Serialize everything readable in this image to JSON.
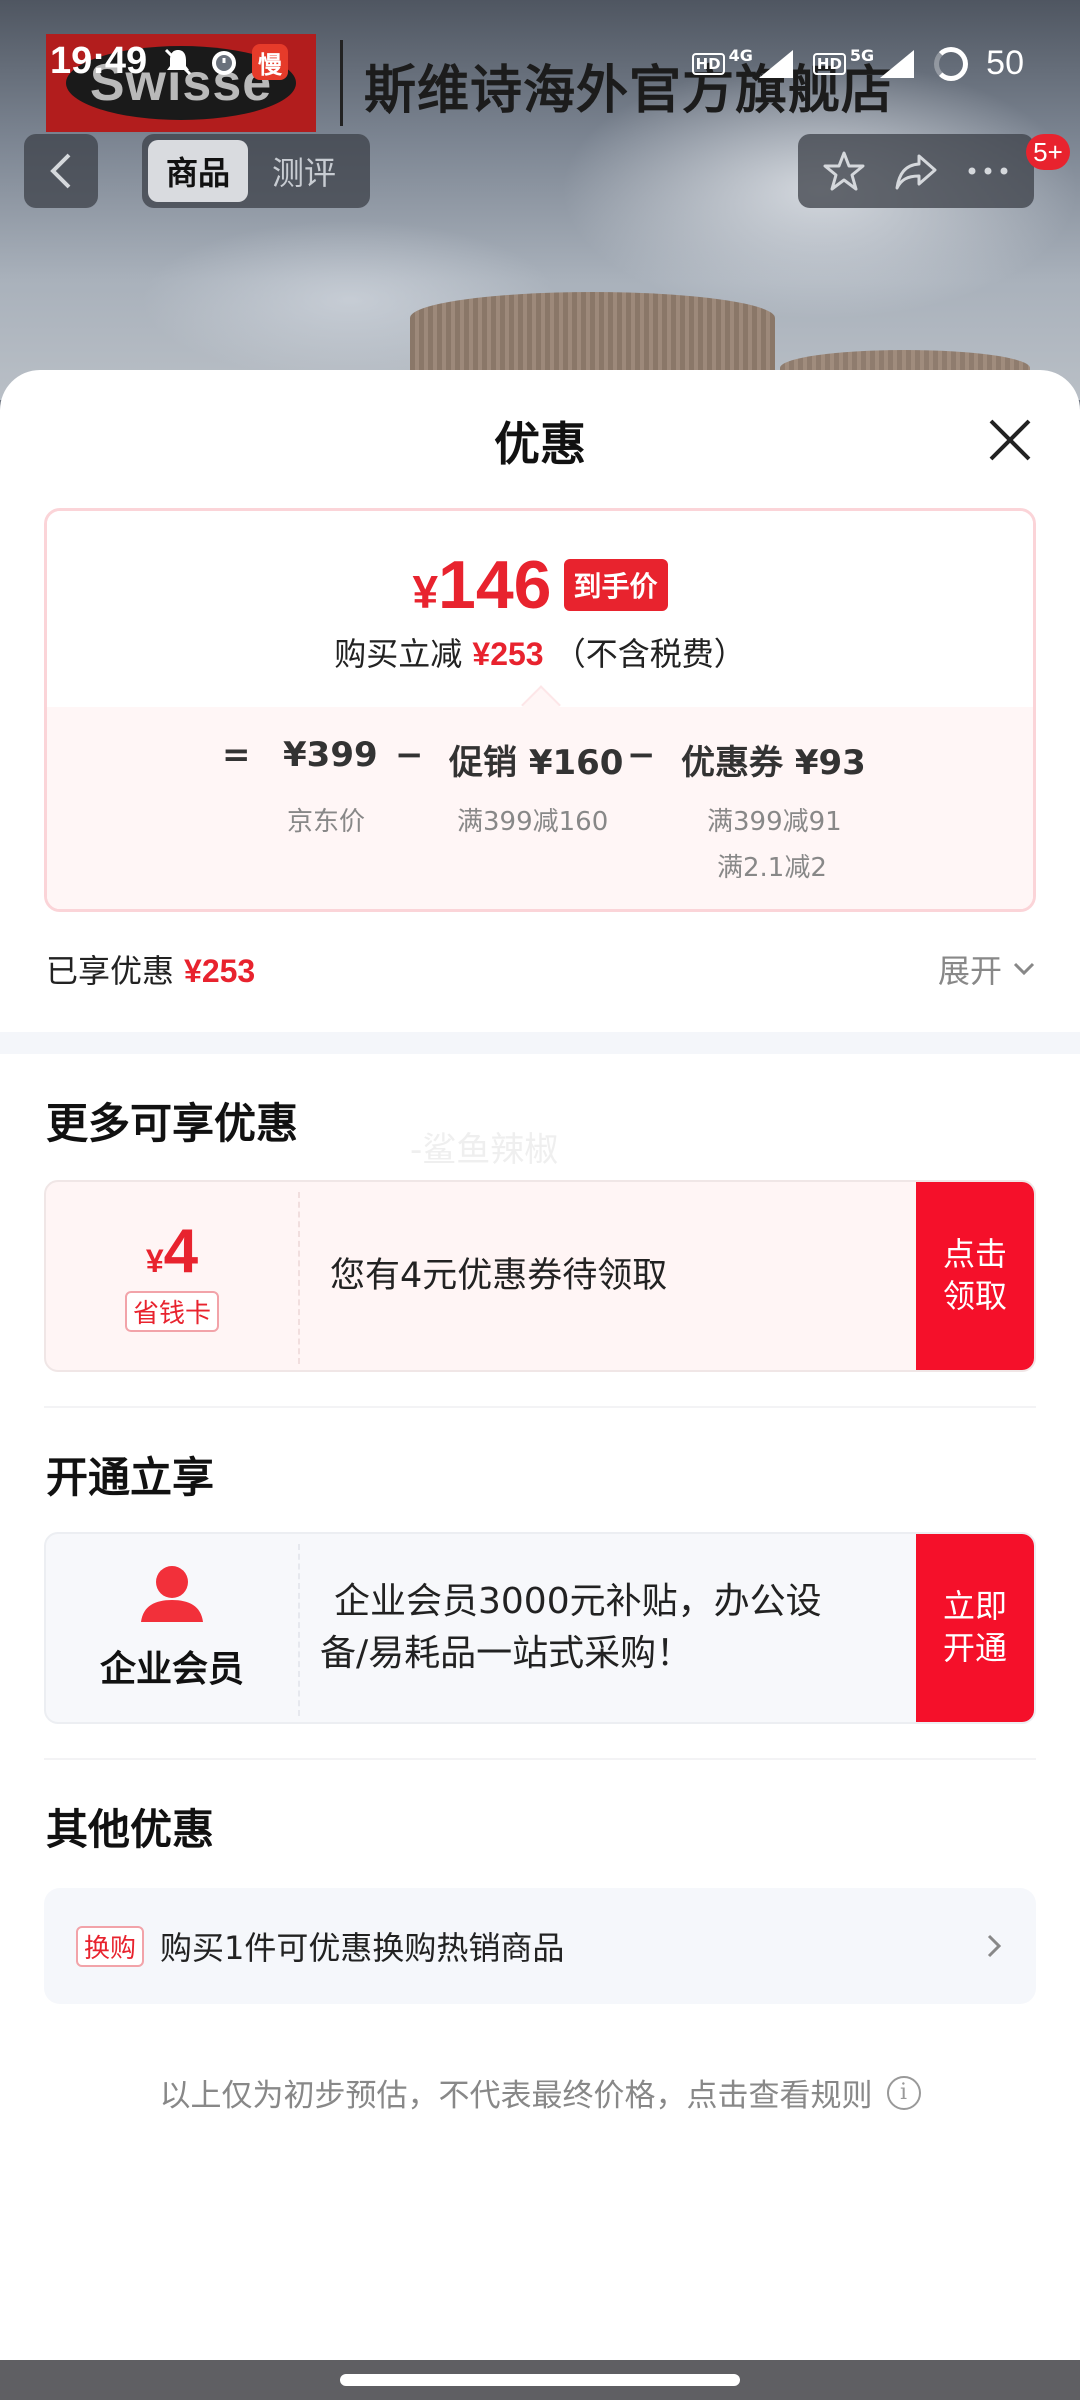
{
  "status_bar": {
    "time": "19:49",
    "app_badge": "慢",
    "sim1_type": "HD",
    "sim1_network": "4G",
    "sim2_type": "HD",
    "sim2_network": "5G",
    "battery": "50"
  },
  "store": {
    "logo_text": "Swisse",
    "name": "斯维诗海外官方旗舰店",
    "logo_color": "#b21d1d"
  },
  "top_nav": {
    "tabs": [
      {
        "label": "商品",
        "active": true
      },
      {
        "label": "测评",
        "active": false
      }
    ],
    "message_badge": "5+"
  },
  "sheet": {
    "title": "优惠",
    "price": {
      "currency": "¥",
      "final_price": "146",
      "final_tag": "到手价",
      "saving_prefix": "购买立减",
      "saving_amount": "¥253",
      "saving_suffix": "（不含税费）"
    },
    "breakdown": {
      "equals": "=",
      "base_price": "¥399",
      "base_label": "京东价",
      "minus1": "−",
      "promo": "促销 ¥160",
      "promo_note": "满399减160",
      "minus2": "−",
      "coupon": "优惠券 ¥93",
      "coupon_note_1": "满399减91",
      "coupon_note_2": "满2.1减2"
    },
    "enjoyed_label": "已享优惠",
    "enjoyed_amount": "¥253",
    "expand_label": "展开",
    "more_section": {
      "title": "更多可享优惠",
      "card": {
        "currency": "¥",
        "amount": "4",
        "tag": "省钱卡",
        "text": "您有4元优惠券待领取",
        "button_line1": "点击",
        "button_line2": "领取"
      }
    },
    "open_section": {
      "title": "开通立享",
      "card": {
        "name": "企业会员",
        "text_line1": "企业会员3000元补贴，办公设",
        "text_line2": "备/易耗品一站式采购！",
        "button_line1": "立即",
        "button_line2": "开通"
      }
    },
    "other_section": {
      "title": "其他优惠",
      "tag": "换购",
      "text": "购买1件可优惠换购热销商品"
    },
    "disclaimer": "以上仅为初步预估，不代表最终价格，点击查看规则",
    "watermark": "-鲨鱼辣椒"
  },
  "colors": {
    "accent_red": "#e8232e",
    "button_red": "#f5102a",
    "card_pink": "#fff6f6"
  }
}
